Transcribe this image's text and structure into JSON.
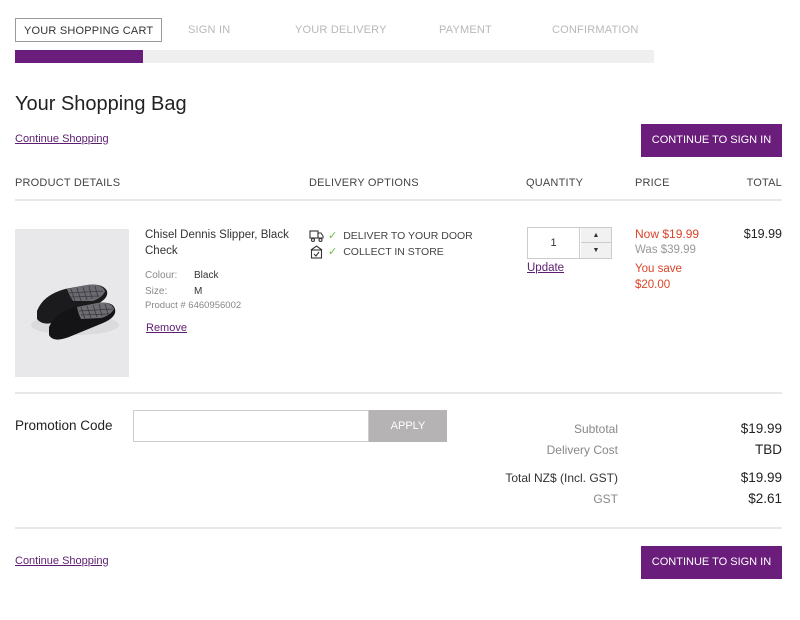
{
  "steps": [
    "YOUR SHOPPING CART",
    "SIGN IN",
    "YOUR DELIVERY",
    "PAYMENT",
    "CONFIRMATION"
  ],
  "page_title": "Your Shopping Bag",
  "continue_shopping": "Continue Shopping",
  "continue_signin": "CONTINUE TO SIGN IN",
  "columns": {
    "product": "PRODUCT DETAILS",
    "delivery": "DELIVERY OPTIONS",
    "quantity": "QUANTITY",
    "price": "PRICE",
    "total": "TOTAL"
  },
  "item": {
    "name": "Chisel Dennis Slipper, Black Check",
    "colour_label": "Colour:",
    "colour": "Black",
    "size_label": "Size:",
    "size": "M",
    "product_number": "Product # 6460956002",
    "remove": "Remove",
    "delivery_options": [
      "DELIVER TO YOUR DOOR",
      "COLLECT IN STORE"
    ],
    "quantity": "1",
    "update": "Update",
    "price_now": "Now $19.99",
    "price_was": "Was $39.99",
    "you_save": "You save",
    "save_amount": "$20.00",
    "total": "$19.99"
  },
  "promo": {
    "label": "Promotion Code",
    "placeholder": "",
    "apply": "APPLY"
  },
  "summary": {
    "subtotal_label": "Subtotal",
    "subtotal": "$19.99",
    "delivery_label": "Delivery Cost",
    "delivery": "TBD",
    "total_label": "Total NZ$ (Incl. GST)",
    "total": "$19.99",
    "gst_label": "GST",
    "gst": "$2.61"
  },
  "colors": {
    "brand": "#6b1d7c",
    "sale": "#d9442a",
    "check": "#6cbd45"
  },
  "icons": {
    "truck": "truck-icon",
    "store": "store-icon",
    "check": "check-icon"
  }
}
